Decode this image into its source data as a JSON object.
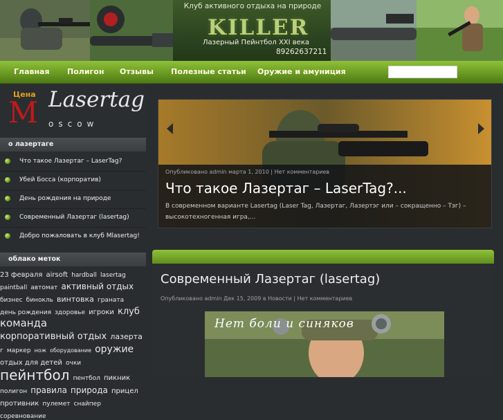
{
  "header": {
    "tagline": "Клуб активного отдыха на природе",
    "logo": "KILLER",
    "subtitle": "Лазерный Пейнтбол XXI века",
    "phone": "89262637211"
  },
  "nav": {
    "items": [
      "Главная",
      "Полигон",
      "Отзывы",
      "Полезные статьи",
      "Оружие и амуниция"
    ]
  },
  "sidebar": {
    "logo_price": "Цена",
    "logo_text": "Lasertag",
    "logo_m": "M",
    "logo_city": "oscow",
    "about_heading": "о лазертаге",
    "about_items": [
      "Что такое Лазертаг – LaserTag?",
      "Убей Босса (корпоратив)",
      "День рождения на природе",
      "Современный Лазертаг (lasertag)",
      "Добро пожаловать в клуб Mlasertag!"
    ],
    "tags_heading": "облако меток",
    "tags": [
      {
        "text": "23 февраля",
        "size": 10
      },
      {
        "text": "airsoft",
        "size": 10
      },
      {
        "text": "hardball",
        "size": 9
      },
      {
        "text": "lasertag",
        "size": 9
      },
      {
        "text": "paintball",
        "size": 9
      },
      {
        "text": "автомат",
        "size": 9
      },
      {
        "text": "активный отдых",
        "size": 12
      },
      {
        "text": "бизнес",
        "size": 9
      },
      {
        "text": "бинокль",
        "size": 9
      },
      {
        "text": "винтовка",
        "size": 11
      },
      {
        "text": "граната",
        "size": 9
      },
      {
        "text": "день рождения",
        "size": 9
      },
      {
        "text": "здоровье",
        "size": 9
      },
      {
        "text": "игроки",
        "size": 10
      },
      {
        "text": "клуб",
        "size": 13
      },
      {
        "text": "команда",
        "size": 15
      },
      {
        "text": "корпоративный отдых",
        "size": 13
      },
      {
        "text": "лазерта",
        "size": 11
      },
      {
        "text": "г",
        "size": 9
      },
      {
        "text": "маркер",
        "size": 9
      },
      {
        "text": "нож",
        "size": 8
      },
      {
        "text": "оборудование",
        "size": 8
      },
      {
        "text": "оружие",
        "size": 14
      },
      {
        "text": "отдых для детей",
        "size": 10
      },
      {
        "text": "очки",
        "size": 9
      },
      {
        "text": "пейнтбол",
        "size": 20
      },
      {
        "text": "пентбол",
        "size": 9
      },
      {
        "text": "пикник",
        "size": 10
      },
      {
        "text": "полигон",
        "size": 9
      },
      {
        "text": "правила",
        "size": 12
      },
      {
        "text": "природа",
        "size": 12
      },
      {
        "text": "прицел",
        "size": 10
      },
      {
        "text": "противник",
        "size": 10
      },
      {
        "text": "пулемет",
        "size": 9
      },
      {
        "text": "снайпер",
        "size": 9
      },
      {
        "text": "соревнование",
        "size": 9
      }
    ]
  },
  "slider": {
    "meta": "Опубликовано admin марта 1, 2010 | Нет комментариев",
    "title": "Что такое Лазертаг – LaserTag?...",
    "excerpt": "В современном варианте Lasertag (Laser Tag, Лазертаг, Лазертэг или – сокращенно – Тэг) – высокотехногенная игра,..."
  },
  "post": {
    "title": "Современный Лазертаг (lasertag)",
    "meta": "Опубликовано admin Дек 15, 2009 в Новости | Нет комментариев",
    "image_text": "Нет боли и синяков"
  },
  "colors": {
    "nav_green": "#7aad2c",
    "page_bg": "#2a2d2f",
    "logo_red": "#c11a1a"
  }
}
